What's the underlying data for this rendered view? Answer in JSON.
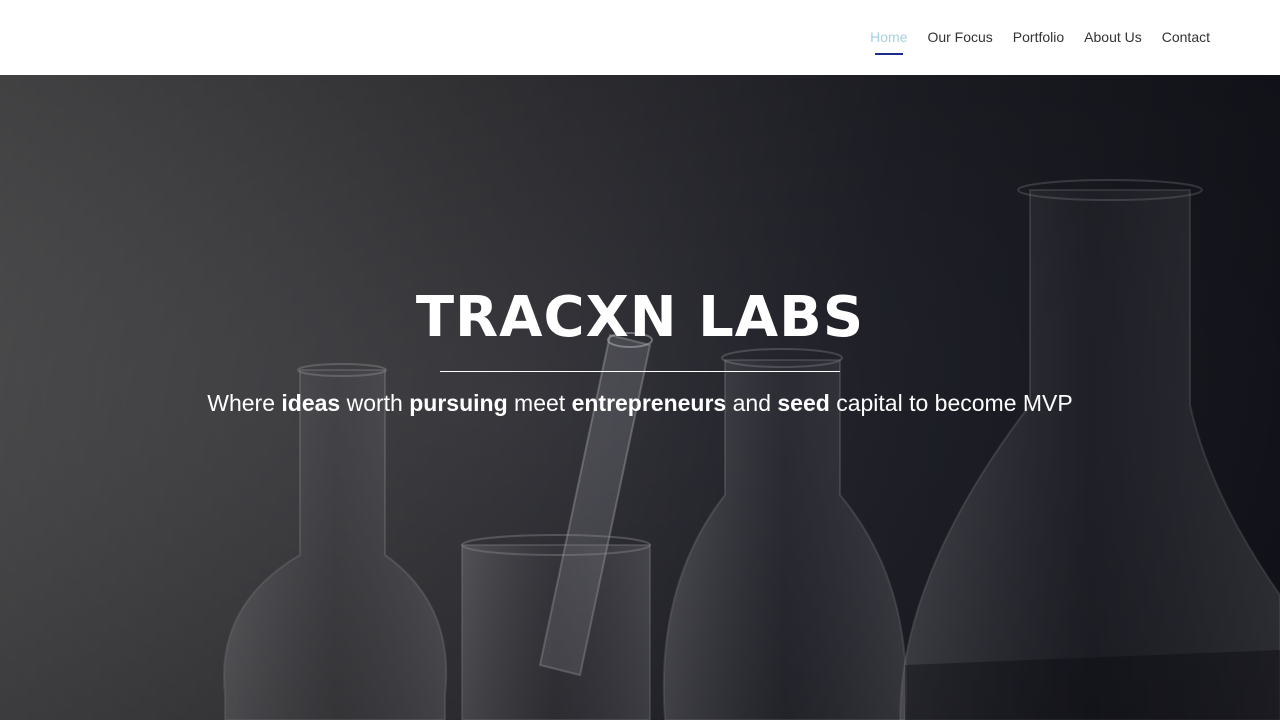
{
  "nav": {
    "items": [
      {
        "label": "Home",
        "active": true
      },
      {
        "label": "Our Focus",
        "active": false
      },
      {
        "label": "Portfolio",
        "active": false
      },
      {
        "label": "About Us",
        "active": false
      },
      {
        "label": "Contact",
        "active": false
      }
    ],
    "active_color": "#a6cfe0",
    "indicator_color": "#1d2b8f"
  },
  "hero": {
    "title": "TRACXN LABS",
    "tagline": {
      "t1": "Where ",
      "b1": "ideas",
      "t2": " worth ",
      "b2": "pursuing",
      "t3": " meet ",
      "b3": "entrepreneurs",
      "t4": " and ",
      "b4": "seed",
      "t5": " capital to become MVP"
    },
    "background": "laboratory-glassware-image"
  }
}
